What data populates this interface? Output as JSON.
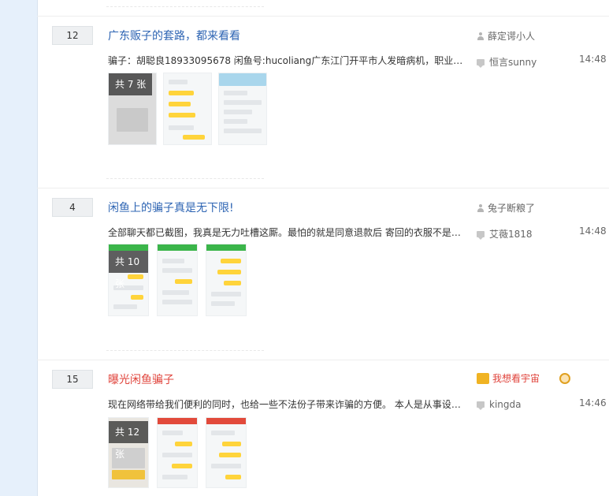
{
  "threads": [
    {
      "reply_count": "12",
      "title": "广东贩子的套路，都来看看",
      "excerpt": "骗子：胡聪良18933095678 闲鱼号:hucoliang广东江门开平市人发暗病机，职业二...",
      "author": "薛定谔小人",
      "last_reply_user": "恒言sunny",
      "time": "14:48",
      "image_count": "共 7 张"
    },
    {
      "reply_count": "4",
      "title": "闲鱼上的骗子真是无下限!",
      "excerpt": "全部聊天都已截图，我真是无力吐槽这厮。最怕的就是同意退款后 寄回的衣服不是我...",
      "author": "兔子断粮了",
      "last_reply_user": "艾薇1818",
      "time": "14:48",
      "image_count": "共 10 张"
    },
    {
      "reply_count": "15",
      "title": "曝光闲鱼骗子",
      "excerpt": "现在网络带给我们便利的同时，也给一些不法份子带来诈骗的方便。 本人是从事设计...",
      "author": "我想看宇宙",
      "last_reply_user": "kingda",
      "time": "14:46",
      "image_count": "共 12 张"
    }
  ],
  "colors": {
    "title_link": "#2d64b3",
    "title_highlight": "#e0443c",
    "sidebar_bg": "#e6f0fb"
  }
}
